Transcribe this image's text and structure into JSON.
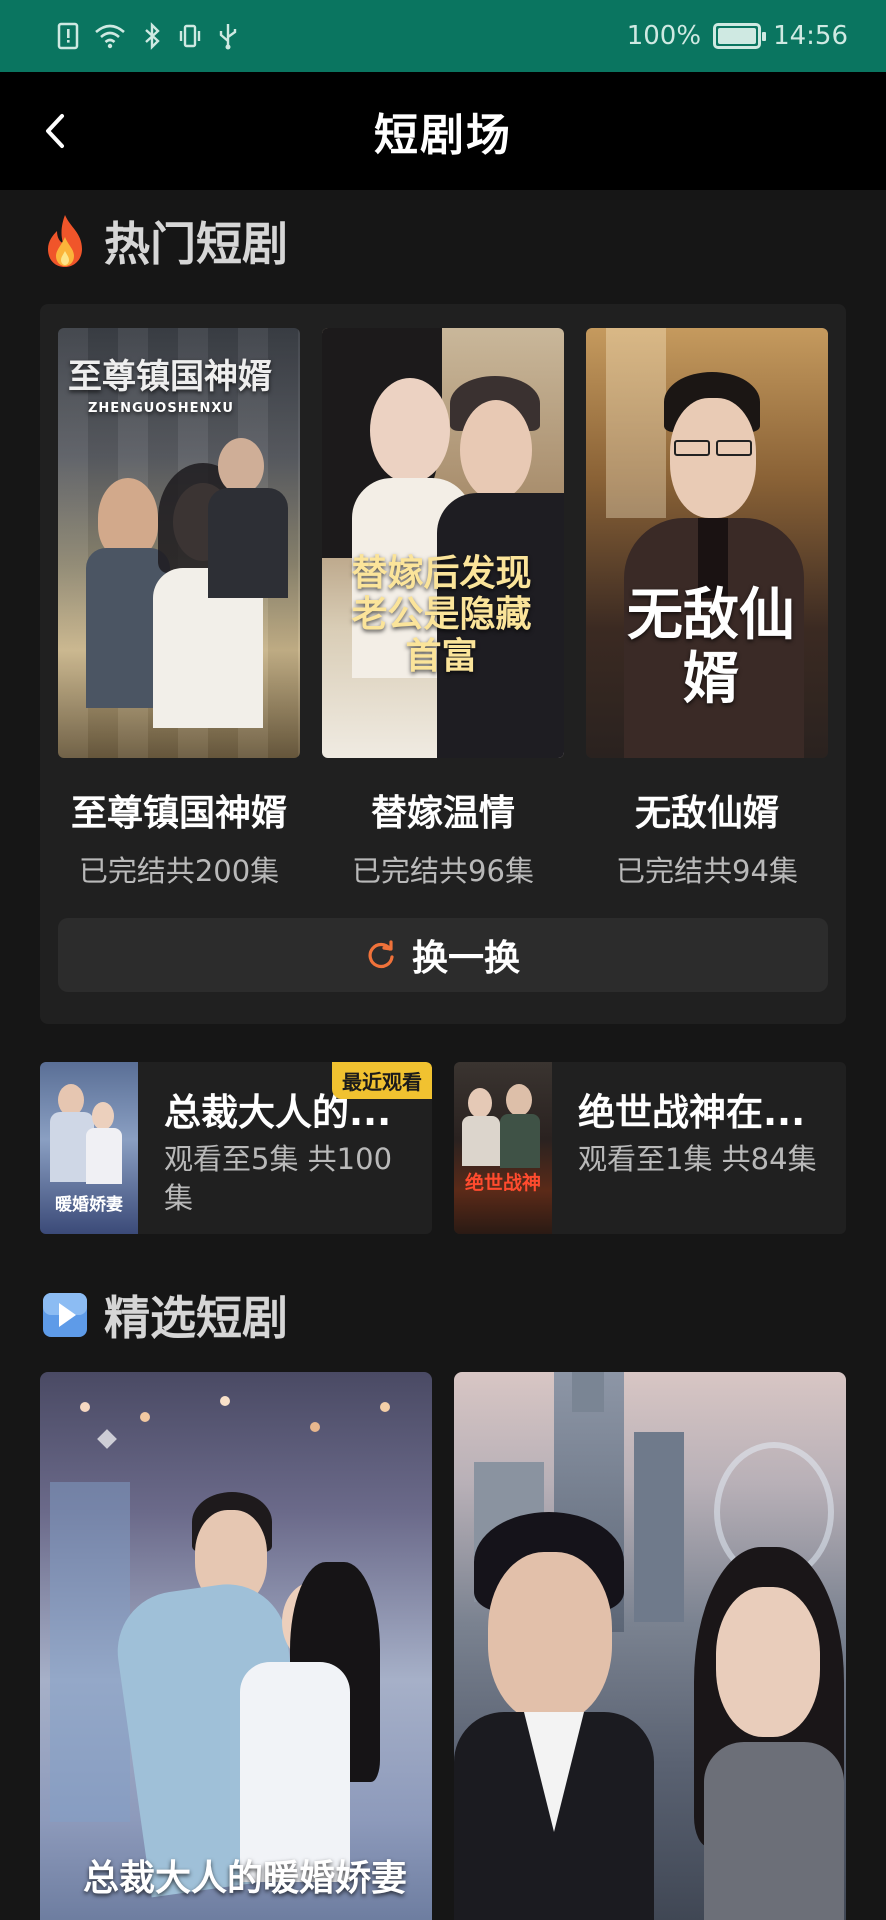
{
  "status_bar": {
    "battery": "100%",
    "time": "14:56",
    "icons": [
      "sim-alert-icon",
      "wifi-icon",
      "bluetooth-icon",
      "vibrate-icon",
      "usb-icon"
    ]
  },
  "nav": {
    "title": "短剧场",
    "back_icon": "chevron-left-icon"
  },
  "hot_section": {
    "emoji": "fire-icon",
    "title": "热门短剧",
    "items": [
      {
        "name": "至尊镇国神婿",
        "status": "已完结共200集",
        "poster_text": "至尊镇国神婿",
        "poster_sub": "ZHENGUOSHENXU"
      },
      {
        "name": "替嫁温情",
        "status": "已完结共96集",
        "poster_text": "替嫁后发现老公是隐藏首富"
      },
      {
        "name": "无敌仙婿",
        "status": "已完结共94集",
        "poster_text": "无敌仙婿"
      }
    ],
    "refresh_label": "换一换",
    "refresh_icon": "refresh-icon"
  },
  "recent": [
    {
      "title": "总裁大人的...",
      "progress": "观看至5集 共100集",
      "badge": "最近观看",
      "thumb_text": "暖婚娇妻"
    },
    {
      "title": "绝世战神在...",
      "progress": "观看至1集 共84集",
      "badge": "",
      "thumb_text": "绝世战神"
    }
  ],
  "featured_section": {
    "emoji": "play-button-icon",
    "title": "精选短剧",
    "items": [
      {
        "poster_text": "总裁大人的暖婚娇妻"
      },
      {
        "poster_text": ""
      }
    ]
  },
  "colors": {
    "status_bar": "#0a7560",
    "background": "#161616",
    "card": "#202020",
    "accent_orange": "#f0723a",
    "badge_yellow": "#f1c230"
  }
}
